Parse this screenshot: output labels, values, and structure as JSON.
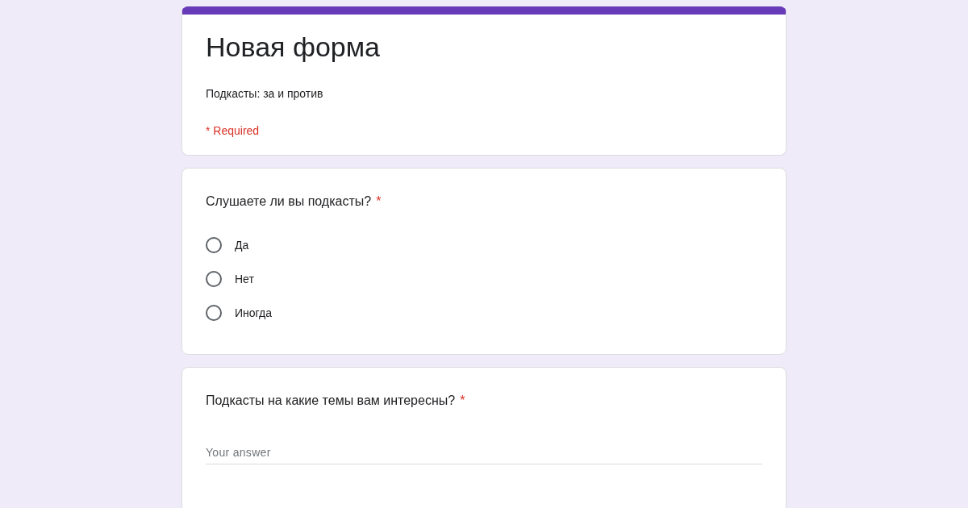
{
  "form": {
    "title": "Новая форма",
    "description": "Подкасты: за и против",
    "required_note": "* Required"
  },
  "questions": [
    {
      "kind": "radio",
      "text": "Слушаете ли вы подкасты?",
      "required_mark": "*",
      "options": [
        {
          "label": "Да",
          "selected": false
        },
        {
          "label": "Нет",
          "selected": false
        },
        {
          "label": "Иногда",
          "selected": false
        }
      ]
    },
    {
      "kind": "text",
      "text": "Подкасты на какие темы вам интересны?",
      "required_mark": "*",
      "placeholder": "Your answer"
    }
  ]
}
